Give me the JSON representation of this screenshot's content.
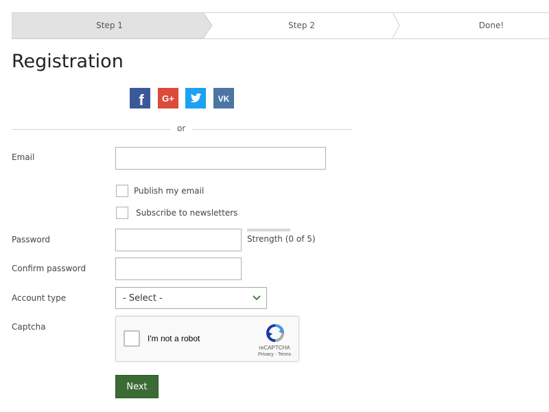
{
  "steps": [
    {
      "label": "Step 1",
      "active": true
    },
    {
      "label": "Step 2",
      "active": false
    },
    {
      "label": "Done!",
      "active": false
    }
  ],
  "page_title": "Registration",
  "social": [
    {
      "icon": "facebook-icon",
      "glyph": "f",
      "color": "#3b5998"
    },
    {
      "icon": "google-plus-icon",
      "glyph": "G+",
      "color": "#dc4a38"
    },
    {
      "icon": "twitter-icon",
      "glyph": "",
      "color": "#1da1f2"
    },
    {
      "icon": "vk-icon",
      "glyph": "VK",
      "color": "#4c75a3"
    }
  ],
  "divider_text": "or",
  "form": {
    "email_label": "Email",
    "email_value": "",
    "publish_email_label": "Publish my email",
    "subscribe_label": "Subscribe to newsletters",
    "password_label": "Password",
    "password_value": "",
    "strength_text": "Strength (0 of 5)",
    "strength_level": 0,
    "strength_max": 5,
    "confirm_label": "Confirm password",
    "confirm_value": "",
    "account_type_label": "Account type",
    "account_type_value": "- Select -",
    "captcha_label": "Captcha"
  },
  "captcha": {
    "checkbox_label": "I'm not a robot",
    "brand": "reCAPTCHA",
    "links": "Privacy - Terms"
  },
  "next_label": "Next",
  "colors": {
    "accent": "#3a6b35",
    "chevron": "#3b8a2f",
    "step_active_bg": "#e2e2e2",
    "step_border": "#cfcfcf"
  }
}
